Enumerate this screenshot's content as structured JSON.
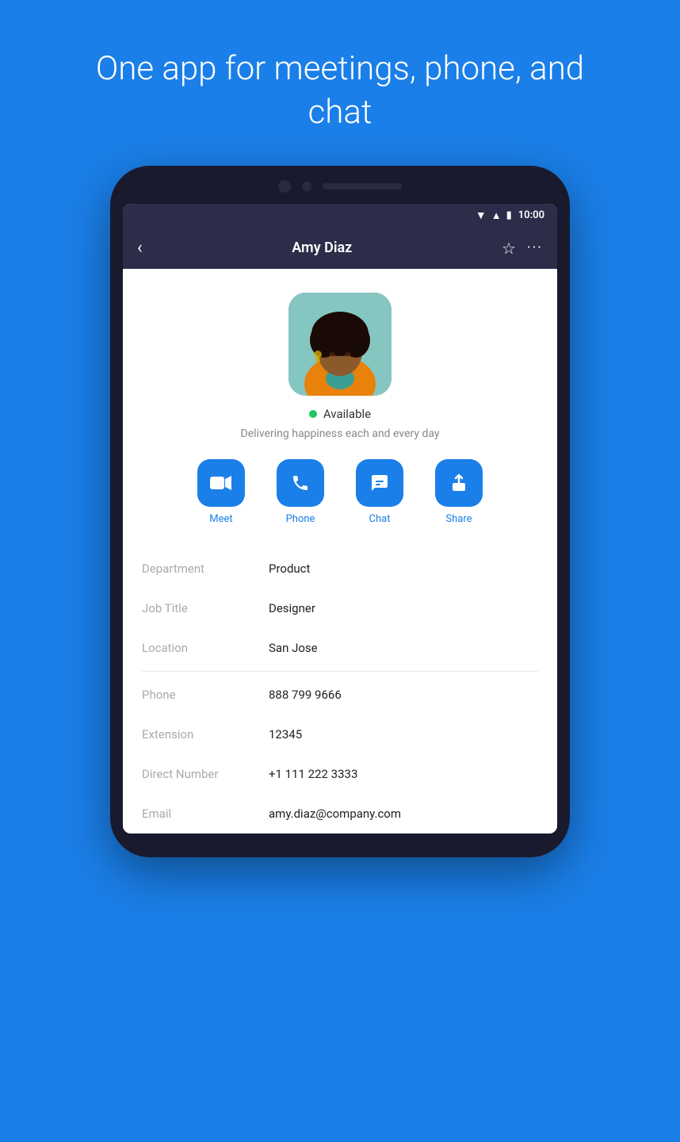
{
  "page": {
    "headline": "One app for meetings, phone, and chat",
    "background_color": "#1a7fe8"
  },
  "status_bar": {
    "time": "10:00"
  },
  "header": {
    "back_label": "‹",
    "title": "Amy Diaz",
    "star_label": "☆",
    "more_label": "···"
  },
  "profile": {
    "status": "Available",
    "status_message": "Delivering happiness each and every day",
    "avatar_alt": "Amy Diaz"
  },
  "actions": [
    {
      "id": "meet",
      "label": "Meet",
      "icon": "video-icon"
    },
    {
      "id": "phone",
      "label": "Phone",
      "icon": "phone-icon"
    },
    {
      "id": "chat",
      "label": "Chat",
      "icon": "chat-icon"
    },
    {
      "id": "share",
      "label": "Share",
      "icon": "share-icon"
    }
  ],
  "info_fields": [
    {
      "label": "Department",
      "value": "Product"
    },
    {
      "label": "Job Title",
      "value": "Designer"
    },
    {
      "label": "Location",
      "value": "San Jose"
    }
  ],
  "contact_fields": [
    {
      "label": "Phone",
      "value": "888 799 9666"
    },
    {
      "label": "Extension",
      "value": "12345"
    },
    {
      "label": "Direct Number",
      "value": "+1 111 222 3333"
    },
    {
      "label": "Email",
      "value": "amy.diaz@company.com"
    }
  ]
}
